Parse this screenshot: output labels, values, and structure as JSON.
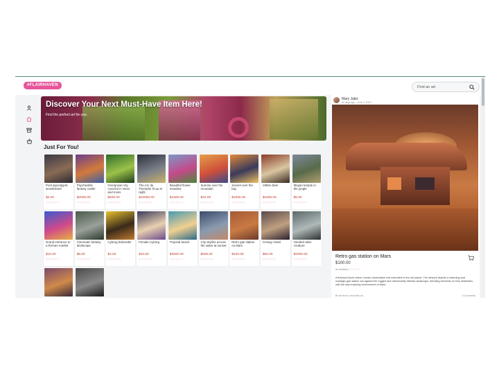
{
  "brand": {
    "logo": "#FLAIRHAVEN",
    "logo_color": "#e6569b"
  },
  "search": {
    "placeholder": "Find an art",
    "icon": "search-icon"
  },
  "nav": [
    {
      "icon": "user-icon",
      "active": false
    },
    {
      "icon": "home-icon",
      "active": true
    },
    {
      "icon": "archive-icon",
      "active": false
    },
    {
      "icon": "basket-icon",
      "active": false
    }
  ],
  "banner": {
    "title": "Discover Your Next Must-Have Item Here!",
    "subtitle": "Find the perfect art for you."
  },
  "section_title": "Just For You!",
  "products": [
    {
      "title": "Post apocalyptic wonderland",
      "price": "$2.00",
      "stars": "♡♡♡♡♡",
      "colors": [
        "#3b3a46",
        "#8a6b55",
        "#2a2a32"
      ]
    },
    {
      "title": "Psychedelic fantasy castle",
      "price": "$2000.00",
      "stars": "♡♡♡♡♡",
      "colors": [
        "#6a3d8a",
        "#d37a3b",
        "#3a5fa8"
      ]
    },
    {
      "title": "Overgrown city covered in vines and moss",
      "price": "$500.00",
      "stars": "♡♡♡♡♡",
      "colors": [
        "#2f6b2a",
        "#9cc24a",
        "#1e3d1a"
      ]
    },
    {
      "title": "The Arc de Triomphe lit up at night",
      "price": "$10000.00",
      "stars": "♡♡♡♡♡",
      "colors": [
        "#2b2f3a",
        "#7a7f88",
        "#c9b36a"
      ]
    },
    {
      "title": "Beautiful flower meadow",
      "price": "$1500.00",
      "stars": "♡♡♡♡♡",
      "colors": [
        "#7a9ac8",
        "#c44a8a",
        "#4a8a3a"
      ]
    },
    {
      "title": "Sunrise over the mountain",
      "price": "$20.00",
      "stars": "♡♡♡♡♡",
      "colors": [
        "#e3a04a",
        "#d0503a",
        "#3a4a8a"
      ]
    },
    {
      "title": "Sunset over the bay",
      "price": "$1000.00",
      "stars": "♡♡♡♡♡",
      "colors": [
        "#e08a3a",
        "#3a3a5a",
        "#f0c060"
      ]
    },
    {
      "title": "1950s diner",
      "price": "$1500.00",
      "stars": "♡♡♡♡♡",
      "colors": [
        "#8a3a2a",
        "#d9c6a0",
        "#3a2a22"
      ]
    },
    {
      "title": "Mayan temple in the jungle",
      "price": "$5.00",
      "stars": "♡♡♡♡♡",
      "colors": [
        "#7a8a9a",
        "#5a6a4a",
        "#b0a070"
      ]
    },
    {
      "title": "Grand entrance to a Roman market",
      "price": "$10.00",
      "stars": "♡♡♡♡♡",
      "colors": [
        "#3a5ad0",
        "#d04a8a",
        "#e8b040"
      ]
    },
    {
      "title": "Cinematic fantasy landscape",
      "price": "$5.00",
      "stars": "♡♡♡♡♡",
      "colors": [
        "#4a5a4a",
        "#9aa09a",
        "#2a3a2a"
      ]
    },
    {
      "title": "Cyborg bartender",
      "price": "$3.00",
      "stars": "♡♡♡♡♡",
      "colors": [
        "#e8c030",
        "#3a2a1a",
        "#c07a30"
      ]
    },
    {
      "title": "Female Cyborg",
      "price": "$10.00",
      "stars": "♡♡♡♡♡",
      "colors": [
        "#3a3a5a",
        "#e8d0b0",
        "#6a4a8a"
      ]
    },
    {
      "title": "Tropical beach",
      "price": "$3200.00",
      "stars": "♡♡♡♡♡",
      "colors": [
        "#4a9ab0",
        "#f0d090",
        "#2a6a8a"
      ]
    },
    {
      "title": "City skyline across the water at sunset",
      "price": "$500.00",
      "stars": "♡♡♡♡♡",
      "colors": [
        "#3a4a6a",
        "#8a9ab0",
        "#c08a6a"
      ]
    },
    {
      "title": "Retro gas station on Mars",
      "price": "$100.00",
      "stars": "♡♡♡♡♡",
      "colors": [
        "#a45a34",
        "#c97a44",
        "#6b3a2a"
      ]
    },
    {
      "title": "Creepy motel",
      "price": "$50.00",
      "stars": "♡♡♡♡♡",
      "colors": [
        "#5a4a4a",
        "#c0a080",
        "#2a2030"
      ]
    },
    {
      "title": "Hooded alien creature",
      "price": "$2000.00",
      "stars": "♡♡♡♡♡",
      "colors": [
        "#5a6a6a",
        "#b0b8b8",
        "#2a3232"
      ]
    },
    {
      "title": "",
      "price": "",
      "stars": "",
      "colors": [
        "#7a4a6a",
        "#d08a4a",
        "#3a2a3a"
      ]
    },
    {
      "title": "",
      "price": "",
      "stars": "",
      "colors": [
        "#4a4a4a",
        "#8a8a8a",
        "#1a1a1a"
      ]
    }
  ],
  "detail": {
    "user": "Mary Jakiz",
    "meta": "49 days ago · June 3, 2023",
    "title": "Retro gas station on Mars",
    "price": "$100.00",
    "reviews_label": "no reviews",
    "stars": "♡♡♡♡♡",
    "description": "A fictional future where human colonization has extended to the red planet. The artwork depicts a charming and nostalgic gas station set against the rugged and otherworldly Martian landscape, blending elements of retro aesthetics with the awe-inspiring environment of Mars.",
    "footer_left": "Be the first to heart this art",
    "footer_right": "0 Comments"
  }
}
